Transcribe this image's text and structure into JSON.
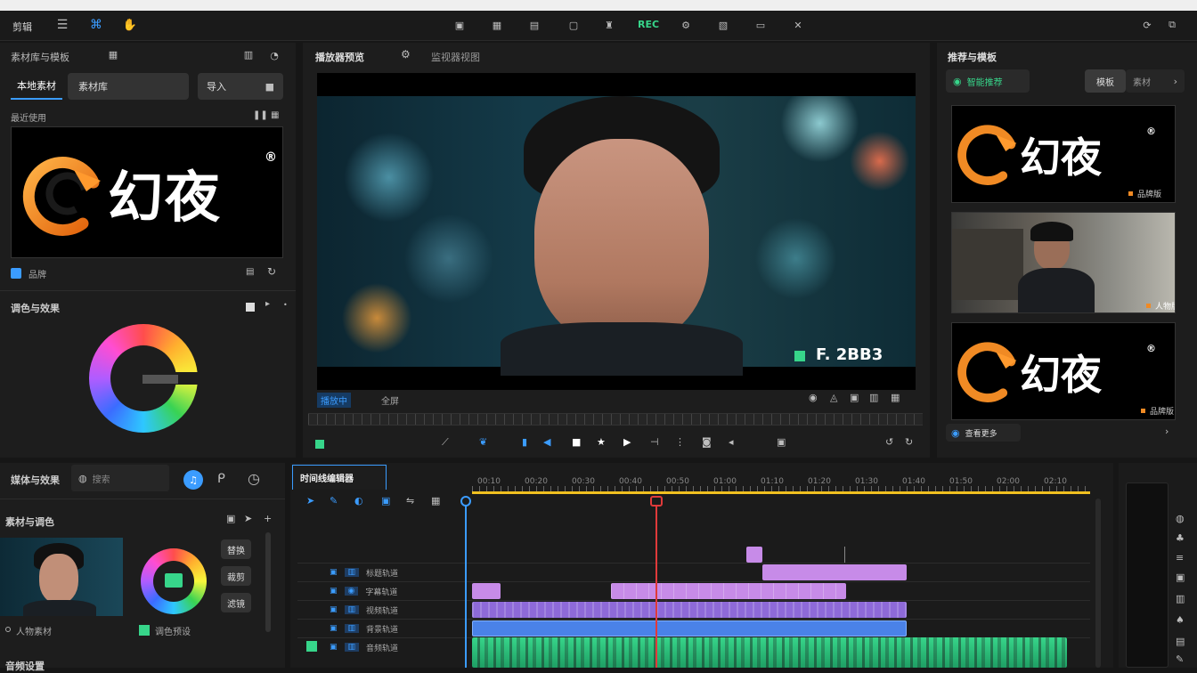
{
  "titlebar": {
    "menu_label": "剪辑"
  },
  "toolbar": {
    "record_label": "REC",
    "icons": [
      "import-icon",
      "layout-icon",
      "export-icon",
      "robot-icon",
      "settings-icon",
      "document-icon",
      "bookmark-icon",
      "tools-icon"
    ]
  },
  "left_panel": {
    "title": "素材库与模板",
    "tabs": [
      "本地素材",
      "素材库",
      "导入"
    ],
    "section_label": "最近使用",
    "logo_text": "幻夜",
    "logo_mark": "®",
    "footer_label": "品牌",
    "color_section_title": "调色与效果"
  },
  "preview": {
    "title": "播放器预览",
    "tab2": "监视器视图",
    "timecode": "F. 2BB3",
    "status_label": "播放中",
    "quality_label": "全屏"
  },
  "right_panel": {
    "title": "推荐与模板",
    "tag_label": "智能推荐",
    "tabs": [
      "模板",
      "素材"
    ],
    "cards": [
      {
        "logo": "幻夜",
        "mark": "®",
        "label": "品牌版"
      },
      {
        "label": "人物版"
      },
      {
        "logo": "幻夜",
        "mark": "®",
        "label": "品牌版"
      }
    ],
    "footer_label": "查看更多"
  },
  "bottom_left": {
    "title": "媒体与效果",
    "search_placeholder": "搜索",
    "section_title": "素材与调色",
    "buttons": [
      "替换",
      "裁剪",
      "滤镜"
    ],
    "clip_label": "人物素材",
    "color_label": "调色预设",
    "bottom_title": "音频设置"
  },
  "timeline": {
    "tab_label": "时间线编辑器",
    "ruler": [
      "00:10",
      "00:20",
      "00:30",
      "00:40",
      "00:50",
      "01:00",
      "01:10",
      "01:20",
      "01:30",
      "01:40",
      "01:50",
      "02:00",
      "02:10"
    ],
    "tracks": [
      "标题轨道",
      "字幕轨道",
      "视频轨道",
      "背景轨道",
      "音频轨道"
    ]
  },
  "colors": {
    "accent": "#3b9cff",
    "playhead": "#e03a3a",
    "audio": "#37d58a",
    "video": "#8e6ad8",
    "title": "#c78be8",
    "marker": "#f0c020"
  }
}
